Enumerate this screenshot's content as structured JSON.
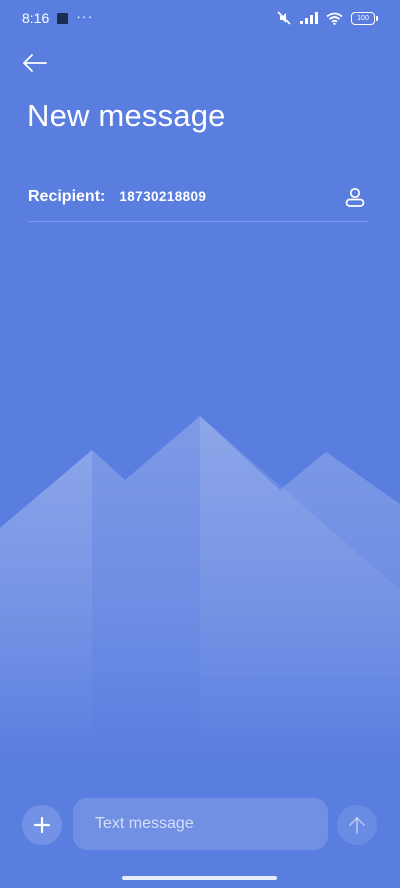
{
  "status_bar": {
    "time": "8:16",
    "more_indicator": "···",
    "battery_level": "100",
    "icons": [
      "notification-square-icon",
      "mute-icon",
      "signal-icon",
      "wifi-icon",
      "battery-icon"
    ]
  },
  "header": {
    "back_icon": "back-arrow-icon",
    "title": "New message"
  },
  "recipient": {
    "label": "Recipient:",
    "value": "18730218809",
    "contact_icon": "contact-person-icon"
  },
  "compose": {
    "attach_icon": "plus-icon",
    "placeholder": "Text message",
    "send_icon": "send-arrow-icon"
  },
  "colors": {
    "background": "#5a7ee0",
    "mountain_light": "#7d9de8",
    "text": "#ffffff"
  }
}
